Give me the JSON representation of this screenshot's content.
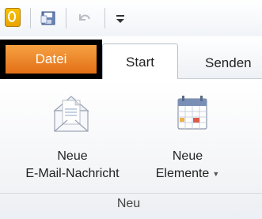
{
  "quick_access": {
    "app_icon": "outlook-icon",
    "items": [
      "save-icon",
      "undo-icon",
      "customize-dropdown-icon"
    ]
  },
  "tabs": {
    "file_label": "Datei",
    "start_label": "Start",
    "send_label": "Senden"
  },
  "ribbon": {
    "new_mail": {
      "line1": "Neue",
      "line2": "E-Mail-Nachricht",
      "icon": "new-email-icon"
    },
    "new_items": {
      "line1": "Neue",
      "line2": "Elemente",
      "icon": "new-items-calendar-icon"
    },
    "group_label": "Neu"
  },
  "colors": {
    "file_tab": "#e8781e",
    "highlight_border": "#000000"
  }
}
